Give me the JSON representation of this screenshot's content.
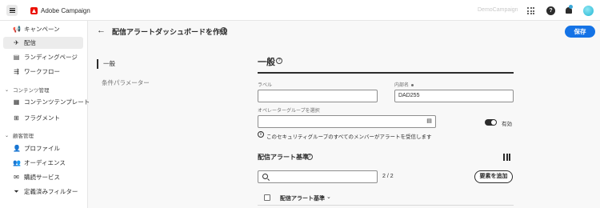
{
  "header": {
    "app_name": "Adobe Campaign",
    "org_name": "DemoCampaign",
    "help_glyph": "?",
    "icons": [
      "menu-icon",
      "adobe-logo",
      "apps-icon",
      "help-icon",
      "bell-icon",
      "avatar"
    ]
  },
  "sidebar": {
    "items_top": [
      {
        "label": "キャンペーン",
        "icon": "megaphone-icon",
        "glyph": "📢"
      },
      {
        "label": "配信",
        "icon": "paper-plane-icon",
        "glyph": "✈"
      },
      {
        "label": "ランディングページ",
        "icon": "landing-page-icon",
        "glyph": "▤"
      },
      {
        "label": "ワークフロー",
        "icon": "workflow-icon",
        "glyph": "⇶"
      }
    ],
    "section_content": "コンテンツ管理",
    "items_content": [
      {
        "label": "コンテンツテンプレート",
        "icon": "template-icon",
        "glyph": "▦"
      },
      {
        "label": "フラグメント",
        "icon": "fragment-icon",
        "glyph": "⊞"
      }
    ],
    "section_customer": "顧客管理",
    "items_customer": [
      {
        "label": "プロファイル",
        "icon": "profile-icon",
        "glyph": "👤"
      },
      {
        "label": "オーディエンス",
        "icon": "audience-icon",
        "glyph": "👥"
      },
      {
        "label": "購読サービス",
        "icon": "subscription-icon",
        "glyph": "✉"
      },
      {
        "label": "定義済みフィルター",
        "icon": "filter-icon",
        "glyph": "⏷"
      }
    ]
  },
  "page": {
    "back_glyph": "←",
    "title": "配信アラートダッシュボードを作成",
    "save_label": "保存"
  },
  "tabs": [
    "一般",
    "条件パラメーター"
  ],
  "form": {
    "section_title": "一般",
    "label_label": "ラベル",
    "label_value": "",
    "internal_name_label": "内部名",
    "internal_name_value": "DAD255",
    "operator_group_label": "オペレーターグループを選択",
    "operator_group_value": "",
    "picker_glyph": "▤",
    "enabled_label": "有効",
    "enabled": true,
    "info_glyph": "i",
    "info_text": "このセキュリティグループのすべてのメンバーがアラートを受信します"
  },
  "criteria": {
    "title": "配信アラート基準",
    "search_placeholder": "",
    "count": "2 / 2",
    "add_label": "要素を追加",
    "column_header": "配信アラート基準",
    "chevron_glyph": "⌄"
  }
}
